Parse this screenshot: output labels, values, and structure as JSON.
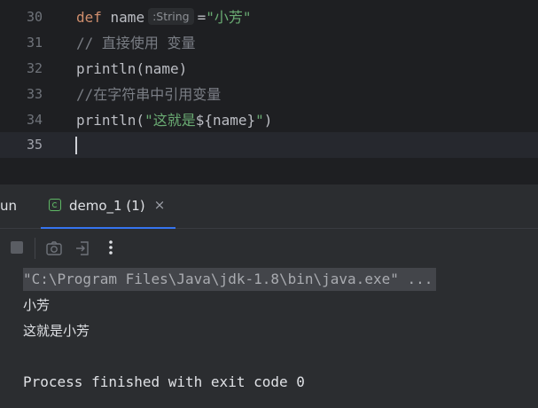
{
  "editor": {
    "line_numbers": [
      "30",
      "31",
      "32",
      "33",
      "34",
      "35"
    ],
    "lines": {
      "l30": {
        "kw": "def",
        "name": " name",
        "hint": ":String",
        "eq": "=",
        "str": "\"小芳\""
      },
      "l31": {
        "comment": "// 直接使用 变量"
      },
      "l32": {
        "text": "println(name)"
      },
      "l33": {
        "comment": "//在字符串中引用变量"
      },
      "l34": {
        "prefix": "println(",
        "str_open": "\"这就是",
        "interp": "${name}",
        "str_close": "\"",
        "suffix": ")"
      },
      "l35": {
        "text": ""
      }
    }
  },
  "tool_window": {
    "title": "un",
    "tab": {
      "label": "demo_1 (1)",
      "close_glyph": "×"
    },
    "toolbar": {
      "icons": [
        "stop-icon",
        "camera-icon",
        "exit-icon",
        "more-icon"
      ]
    },
    "console": {
      "command": "\"C:\\Program Files\\Java\\jdk-1.8\\bin\\java.exe\" ...",
      "output": [
        "小芳",
        "这就是小芳",
        "",
        "Process finished with exit code 0"
      ]
    }
  },
  "colors": {
    "keyword": "#cf8e6d",
    "string": "#6aab73",
    "comment": "#7a7e85",
    "accent": "#3574f0",
    "tab_icon": "#5fb865"
  }
}
